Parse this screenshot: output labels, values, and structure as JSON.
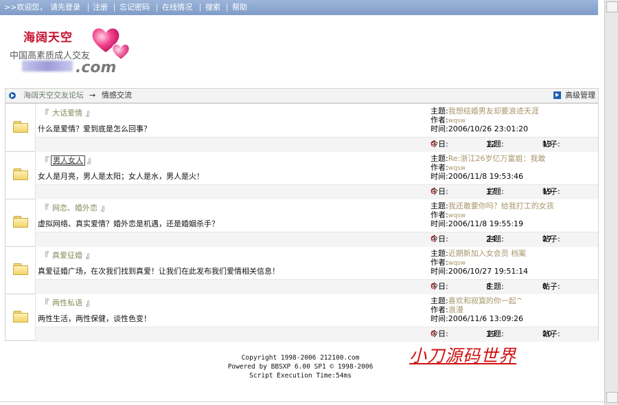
{
  "topbar": {
    "items": [
      ">>欢迎您，",
      "请先登录",
      "注册",
      "忘记密码",
      "在线情况",
      "搜索",
      "帮助"
    ]
  },
  "logo": {
    "name": "海阔天空",
    "slogan": "中国高素质成人交友",
    "domain_suffix": ".com"
  },
  "breadcrumb": {
    "root": "海阔天空交友论坛",
    "arrow": "→",
    "current": "情感交流",
    "admin": "高级管理"
  },
  "labels": {
    "topic": "主题:",
    "author": "作者:",
    "time": "时间:",
    "today": "今日:",
    "topics": "主题:",
    "posts": "帖子:",
    "bracket_open": "『",
    "bracket_close": "』"
  },
  "forums": [
    {
      "name": "大话爱情",
      "description": "什么是爱情？爱到底是怎么回事？",
      "last_topic": "我想结婚男友却要浪迹天涯",
      "last_author": "wqsw",
      "last_time": "2006/10/26 23:01:20",
      "today": "0",
      "topics": "12",
      "posts": "13"
    },
    {
      "name": "男人女人",
      "description": "女人是月亮，男人是太阳；女人是水，男人是火！",
      "last_topic": "Re:浙江26岁亿万富姐：我敢",
      "last_author": "wqsw",
      "last_time": "2006/11/8 19:53:46",
      "today": "0",
      "topics": "17",
      "posts": "19"
    },
    {
      "name": "网恋、婚外恋",
      "description": "虚拟网络、真实爱情？婚外恋是机遇，还是婚姻杀手？",
      "last_topic": "我还敢要你吗？给我打工的女孩",
      "last_author": "wqsw",
      "last_time": "2006/11/8 19:55:19",
      "today": "0",
      "topics": "24",
      "posts": "27"
    },
    {
      "name": "真爱征婚",
      "description": "真爱征婚广场，在次我们找到真爱！让我们在此发布我们爱情相关信息！",
      "last_topic": "近期新加入女会员 档案",
      "last_author": "wqsw",
      "last_time": "2006/10/27 19:51:14",
      "today": "0",
      "topics": "8",
      "posts": "8"
    },
    {
      "name": "两性私语",
      "description": "两性生活，两性保健，谈性色变！",
      "last_topic": "喜欢和寂寞的你一起^",
      "last_author": "浪漫",
      "last_time": "2006/11/6 13:09:26",
      "today": "0",
      "topics": "19",
      "posts": "20"
    }
  ],
  "footer": {
    "line1": "Copyright 1998-2006 212100.com",
    "line2": "Powered by BBSXP 6.00 SP1 © 1998-2006",
    "line3": "Script Execution Time:54ms"
  },
  "watermark": "小刀源码世界",
  "colors": {
    "topbar": "#8ea9d2",
    "logo_red": "#c8102e",
    "olive_text": "#a8956a",
    "count_red": "#d40000"
  }
}
